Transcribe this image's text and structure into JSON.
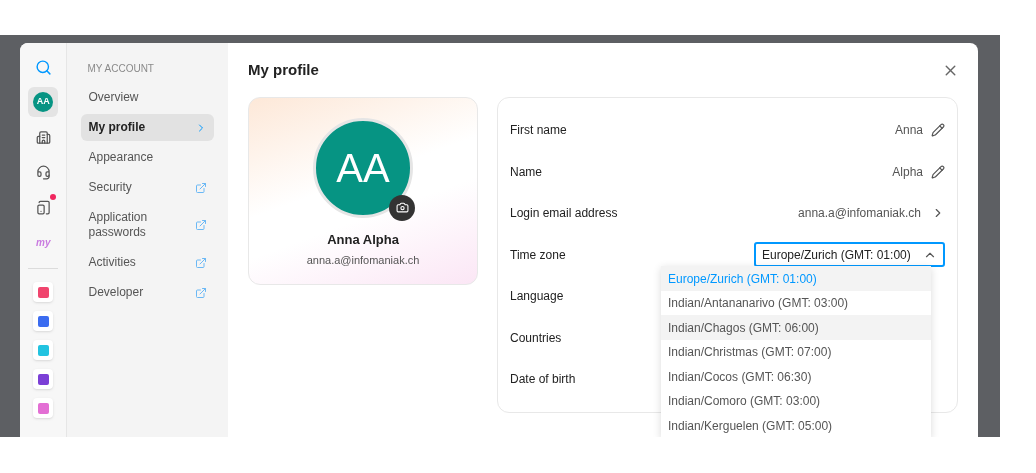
{
  "rail": {
    "items": [
      {
        "kind": "search",
        "selected": false,
        "badge": false
      },
      {
        "kind": "avatar",
        "label": "AA",
        "selected": true,
        "badge": false
      },
      {
        "kind": "building",
        "selected": false,
        "badge": false
      },
      {
        "kind": "headset",
        "selected": false,
        "badge": false
      },
      {
        "kind": "devices",
        "selected": false,
        "badge": true
      },
      {
        "kind": "logo",
        "label": "my",
        "selected": false,
        "badge": false
      }
    ],
    "apps": [
      {
        "color": "#f0456e"
      },
      {
        "color": "#3b6cf0"
      },
      {
        "color": "#22c3e0"
      },
      {
        "color": "#7b3fd6"
      },
      {
        "color": "#e36fd4"
      }
    ]
  },
  "nav": {
    "heading": "MY ACCOUNT",
    "items": [
      {
        "label": "Overview",
        "selected": false,
        "external": false
      },
      {
        "label": "My profile",
        "selected": true,
        "external": false
      },
      {
        "label": "Appearance",
        "selected": false,
        "external": false
      },
      {
        "label": "Security",
        "selected": false,
        "external": true
      },
      {
        "label": "Application passwords",
        "selected": false,
        "external": true
      },
      {
        "label": "Activities",
        "selected": false,
        "external": true
      },
      {
        "label": "Developer",
        "selected": false,
        "external": true
      }
    ]
  },
  "title": "My profile",
  "profile": {
    "initials": "AA",
    "name": "Anna Alpha",
    "email": "anna.a@infomaniak.ch"
  },
  "fields": [
    {
      "label": "First name",
      "kind": "editable",
      "value": "Anna"
    },
    {
      "label": "Name",
      "kind": "editable",
      "value": "Alpha"
    },
    {
      "label": "Login email address",
      "kind": "link",
      "value": "anna.a@infomaniak.ch"
    },
    {
      "label": "Time zone",
      "kind": "select",
      "value": "Europe/Zurich (GMT: 01:00)",
      "expanded": true
    },
    {
      "label": "Language",
      "kind": "empty"
    },
    {
      "label": "Countries",
      "kind": "empty"
    },
    {
      "label": "Date of birth",
      "kind": "empty"
    }
  ],
  "timezone_options": [
    {
      "label": "Europe/Zurich (GMT: 01:00)",
      "selected": true,
      "highlighted": true
    },
    {
      "label": "Indian/Antananarivo (GMT: 03:00)",
      "selected": false,
      "highlighted": false
    },
    {
      "label": "Indian/Chagos (GMT: 06:00)",
      "selected": false,
      "highlighted": true
    },
    {
      "label": "Indian/Christmas (GMT: 07:00)",
      "selected": false,
      "highlighted": false
    },
    {
      "label": "Indian/Cocos (GMT: 06:30)",
      "selected": false,
      "highlighted": false
    },
    {
      "label": "Indian/Comoro (GMT: 03:00)",
      "selected": false,
      "highlighted": false
    },
    {
      "label": "Indian/Kerguelen (GMT: 05:00)",
      "selected": false,
      "highlighted": false
    }
  ]
}
